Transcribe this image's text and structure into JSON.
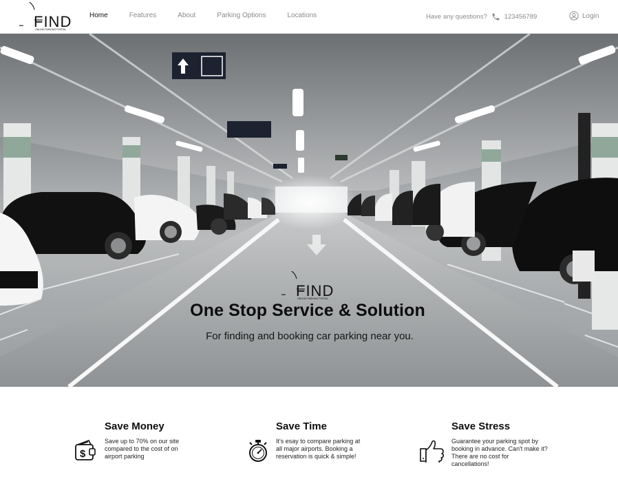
{
  "brand": {
    "logo_word": "FIND",
    "logo_tagline": "ONLINE PARKING PORTAL"
  },
  "nav": {
    "items": [
      {
        "label": "Home",
        "active": true
      },
      {
        "label": "Features",
        "active": false
      },
      {
        "label": "About",
        "active": false
      },
      {
        "label": "Parking Options",
        "active": false
      },
      {
        "label": "Locations",
        "active": false
      }
    ]
  },
  "contact": {
    "question": "Have any questions?",
    "phone_icon": "phone-icon",
    "phone": "123456789"
  },
  "login": {
    "icon": "user-icon",
    "label": "Login"
  },
  "hero": {
    "background": "parking-garage-photo",
    "title": "One Stop Service & Solution",
    "subtitle": "For finding and booking car parking near you."
  },
  "features": [
    {
      "icon": "wallet-dollar-icon",
      "title": "Save Money",
      "text": "Save up to 70% on our site compared to the cost of on airport parking"
    },
    {
      "icon": "stopwatch-icon",
      "title": "Save Time",
      "text": "It's esay to compare parking at all major airports. Booking a reservation is quick & simple!"
    },
    {
      "icon": "thumbs-up-icon",
      "title": "Save Stress",
      "text": "Guarantee your parking spot by booking in advance. Can't make it? There are no cost for cancellations!"
    }
  ],
  "colors": {
    "text_dark": "#0d0d0d",
    "nav_muted": "#8a8a8a",
    "pillar_band": "#8fa89a"
  }
}
